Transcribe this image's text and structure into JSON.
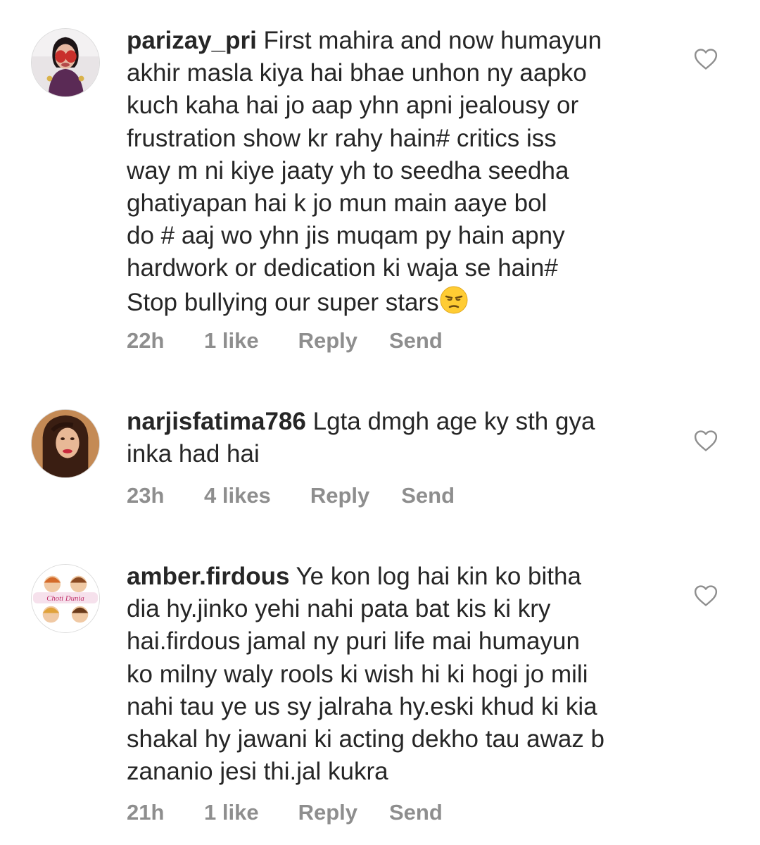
{
  "comments": [
    {
      "username": "parizay_pri",
      "text": "First mahira and now humayun\nakhir masla kiya hai bhae unhon ny aapko\nkuch kaha hai  jo aap yhn apni jealousy or\nfrustration show kr rahy hain# critics iss\nway m ni kiye jaaty yh to seedha seedha\nghatiyapan hai k jo mun main aaye bol\ndo # aaj wo yhn jis muqam py hain apny\nhardwork or dedication ki waja se hain#\nStop bullying our super stars",
      "emoji": "unamused-face",
      "time": "22h",
      "likes": "1 like",
      "reply_label": "Reply",
      "send_label": "Send"
    },
    {
      "username": "narjisfatima786",
      "text": "Lgta dmgh age ky sth gya\ninka had hai",
      "time": "23h",
      "likes": "4 likes",
      "reply_label": "Reply",
      "send_label": "Send"
    },
    {
      "username": "amber.firdous",
      "text": "Ye kon log hai kin ko bitha\ndia hy.jinko yehi nahi pata bat kis ki kry\nhai.firdous jamal ny puri life mai humayun\nko milny waly rools ki wish hi ki hogi jo mili\nnahi tau ye us sy jalraha hy.eski khud ki kia\nshakal hy jawani ki acting dekho tau awaz b\nzananio jesi thi.jal kukra",
      "avatar_text": "Choti Dunia",
      "time": "21h",
      "likes": "1 like",
      "reply_label": "Reply",
      "send_label": "Send"
    }
  ],
  "colors": {
    "text": "#262626",
    "meta": "#8e8e8e",
    "heart_outline": "#8e8e8e"
  }
}
